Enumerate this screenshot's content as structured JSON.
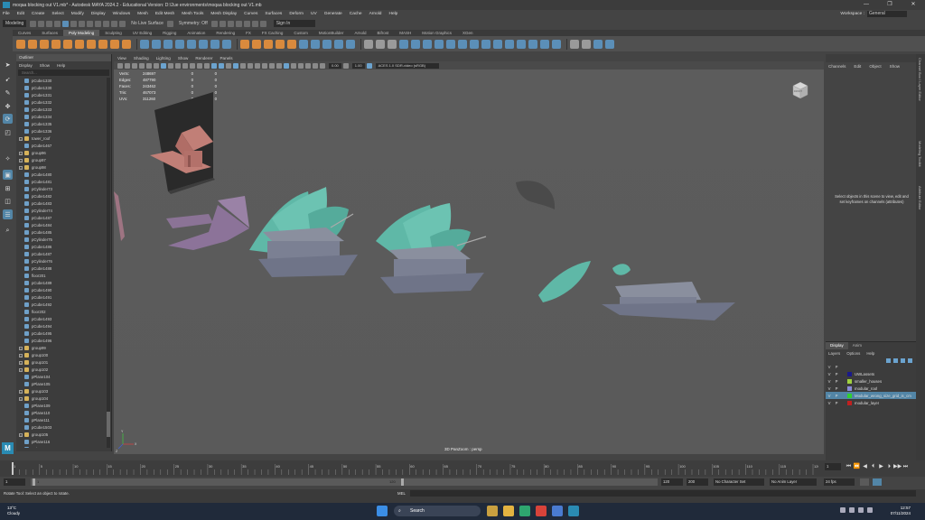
{
  "window": {
    "title": "moqaa blocking out V1.mb* - Autodesk MAYA 2024.2 - Educational Version: D:\\2ue environments\\moqaa blocking out V1.mb",
    "controls": [
      "—",
      "❐",
      "✕"
    ]
  },
  "menu": {
    "items": [
      "File",
      "Edit",
      "Create",
      "Select",
      "Modify",
      "Display",
      "Windows",
      "Mesh",
      "Edit Mesh",
      "Mesh Tools",
      "Mesh Display",
      "Curves",
      "Surfaces",
      "Deform",
      "UV",
      "Generate",
      "Cache",
      "Arnold",
      "Help"
    ],
    "workspace_label": "Workspace :",
    "workspace_value": "General"
  },
  "statusline": {
    "mode": "Modeling",
    "no_live_surface": "No Live Surface",
    "symmetry": "Symmetry: Off",
    "sign_in": "Sign In"
  },
  "shelf": {
    "tabs": [
      "Curves",
      "Surfaces",
      "Poly Modeling",
      "Sculpting",
      "UV Editing",
      "Rigging",
      "Animation",
      "Rendering",
      "FX",
      "FX Caching",
      "Custom",
      "MotionBuilder",
      "Arnold",
      "Bifrost",
      "MASH",
      "Motion Graphics",
      "XGen"
    ],
    "active_tab": "Poly Modeling"
  },
  "outliner": {
    "title": "Outliner",
    "menu": [
      "Display",
      "Show",
      "Help"
    ],
    "search_placeholder": "Search...",
    "items": [
      {
        "label": "pCube1330",
        "group": false,
        "expand": false
      },
      {
        "label": "pCube1330",
        "group": false,
        "expand": false
      },
      {
        "label": "pCube1331",
        "group": false,
        "expand": false
      },
      {
        "label": "pCube1332",
        "group": false,
        "expand": false
      },
      {
        "label": "pCube1333",
        "group": false,
        "expand": false
      },
      {
        "label": "pCube1334",
        "group": false,
        "expand": false
      },
      {
        "label": "pCube1335",
        "group": false,
        "expand": false
      },
      {
        "label": "pCube1336",
        "group": false,
        "expand": false
      },
      {
        "label": "tower_roof",
        "group": true,
        "expand": true
      },
      {
        "label": "pCube1467",
        "group": false,
        "expand": false
      },
      {
        "label": "group96",
        "group": true,
        "expand": true
      },
      {
        "label": "group97",
        "group": true,
        "expand": true
      },
      {
        "label": "group98",
        "group": true,
        "expand": true
      },
      {
        "label": "pCube1480",
        "group": false,
        "expand": false
      },
      {
        "label": "pCube1481",
        "group": false,
        "expand": false
      },
      {
        "label": "pCylinder73",
        "group": false,
        "expand": false
      },
      {
        "label": "pCube1482",
        "group": false,
        "expand": false
      },
      {
        "label": "pCube1483",
        "group": false,
        "expand": false
      },
      {
        "label": "pCylinder74",
        "group": false,
        "expand": false
      },
      {
        "label": "pCube1487",
        "group": false,
        "expand": false
      },
      {
        "label": "pCube1484",
        "group": false,
        "expand": false
      },
      {
        "label": "pCube1485",
        "group": false,
        "expand": false
      },
      {
        "label": "pCylinder75",
        "group": false,
        "expand": false
      },
      {
        "label": "pCube1486",
        "group": false,
        "expand": false
      },
      {
        "label": "pCube1487",
        "group": false,
        "expand": false
      },
      {
        "label": "pCylinder76",
        "group": false,
        "expand": false
      },
      {
        "label": "pCube1488",
        "group": false,
        "expand": false
      },
      {
        "label": "floor201",
        "group": false,
        "expand": false
      },
      {
        "label": "pCube1489",
        "group": false,
        "expand": false
      },
      {
        "label": "pCube1490",
        "group": false,
        "expand": false
      },
      {
        "label": "pCube1491",
        "group": false,
        "expand": false
      },
      {
        "label": "pCube1492",
        "group": false,
        "expand": false
      },
      {
        "label": "floor202",
        "group": false,
        "expand": false
      },
      {
        "label": "pCube1493",
        "group": false,
        "expand": false
      },
      {
        "label": "pCube1494",
        "group": false,
        "expand": false
      },
      {
        "label": "pCube1495",
        "group": false,
        "expand": false
      },
      {
        "label": "pCube1496",
        "group": false,
        "expand": false
      },
      {
        "label": "group99",
        "group": true,
        "expand": true
      },
      {
        "label": "group100",
        "group": true,
        "expand": true
      },
      {
        "label": "group101",
        "group": true,
        "expand": true
      },
      {
        "label": "group102",
        "group": true,
        "expand": true
      },
      {
        "label": "pPlane104",
        "group": false,
        "expand": false
      },
      {
        "label": "pPlane105",
        "group": false,
        "expand": false
      },
      {
        "label": "group103",
        "group": true,
        "expand": true
      },
      {
        "label": "group104",
        "group": true,
        "expand": true
      },
      {
        "label": "pPlane109",
        "group": false,
        "expand": false
      },
      {
        "label": "pPlane110",
        "group": false,
        "expand": false
      },
      {
        "label": "pPlane111",
        "group": false,
        "expand": false
      },
      {
        "label": "pCube1503",
        "group": false,
        "expand": false
      },
      {
        "label": "group105",
        "group": true,
        "expand": true
      },
      {
        "label": "pPlane116",
        "group": false,
        "expand": false
      },
      {
        "label": "pPlane117",
        "group": false,
        "expand": false
      }
    ]
  },
  "viewport": {
    "menu": [
      "View",
      "Shading",
      "Lighting",
      "Show",
      "Renderer",
      "Panels"
    ],
    "exposure": "0.00",
    "gamma": "1.00",
    "colorspace": "ACES 1.0 SDR-video (sRGB)",
    "hud": [
      {
        "key": "Verts:",
        "value": "248697",
        "a": "0",
        "b": "0"
      },
      {
        "key": "Edges:",
        "value": "487790",
        "a": "0",
        "b": "0"
      },
      {
        "key": "Faces:",
        "value": "243462",
        "a": "0",
        "b": "0"
      },
      {
        "key": "Tris:",
        "value": "467073",
        "a": "0",
        "b": "0"
      },
      {
        "key": "UVs:",
        "value": "311260",
        "a": "0",
        "b": "0"
      }
    ],
    "camera_label": "3D PanZoom : persp",
    "viewcube_label": "FRONT",
    "axis_labels": [
      "Y",
      "X",
      "Z"
    ]
  },
  "channelbox": {
    "menu": [
      "Channels",
      "Edit",
      "Object",
      "Show"
    ],
    "message": "Select objects in this scene to view, edit and set keyframes on channels (attributes)"
  },
  "sidetabs": [
    "Channel Box / Layer Editor",
    "Modeling Toolkit",
    "Attribute Editor"
  ],
  "layers": {
    "tabs": [
      "Display",
      "Anim"
    ],
    "active_tab": "Display",
    "menu": [
      "Layers",
      "Options",
      "Help"
    ],
    "header": {
      "v": "V",
      "p": "P"
    },
    "rows": [
      {
        "v": "V",
        "p": "P",
        "name": "UWLassets",
        "color": "#1a1a8a",
        "selected": false
      },
      {
        "v": "V",
        "p": "P",
        "name": "smaller_houses",
        "color": "#a0d040",
        "selected": false
      },
      {
        "v": "V",
        "p": "P",
        "name": "modular_roof",
        "color": "#8a8ad8",
        "selected": false
      },
      {
        "v": "V",
        "p": "P",
        "name": "Modular_wrong_size_grid_is_cm",
        "color": "#30d030",
        "selected": true
      },
      {
        "v": "V",
        "p": "P",
        "name": "modular_layer",
        "color": "#c02020",
        "selected": false
      }
    ]
  },
  "timeline": {
    "ticks": [
      "1",
      "5",
      "10",
      "15",
      "20",
      "25",
      "30",
      "35",
      "40",
      "45",
      "50",
      "55",
      "60",
      "65",
      "70",
      "75",
      "80",
      "85",
      "90",
      "95",
      "100",
      "105",
      "110",
      "115",
      "120"
    ],
    "current_frame": "1",
    "playback": [
      "⏮",
      "⏪",
      "◀",
      "⏴",
      "▶",
      "⏵",
      "▶▶",
      "⏭"
    ]
  },
  "range": {
    "start": "1",
    "inner_start": "1",
    "inner_end": "120",
    "end": "120",
    "max": "200",
    "no_character_set": "No Character Set",
    "no_anim_layer": "No Anim Layer",
    "fps": "24 fps"
  },
  "cmdline": {
    "help": "Rotate Tool: Select an object to rotate.",
    "mel": "MEL"
  },
  "taskbar": {
    "temp": "13°C",
    "weather": "Cloudy",
    "search": "Search",
    "time": "12:57",
    "date": "07/11/2024"
  }
}
